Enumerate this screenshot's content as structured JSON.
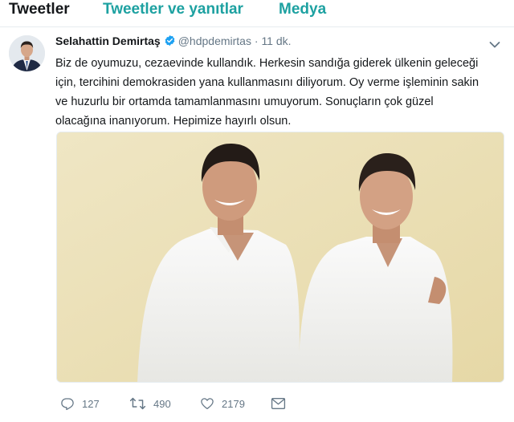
{
  "tabs": [
    {
      "label": "Tweetler",
      "active": true
    },
    {
      "label": "Tweetler ve yanıtlar",
      "active": false
    },
    {
      "label": "Medya",
      "active": false
    }
  ],
  "colors": {
    "tab_active": "#14171a",
    "tab_inactive": "#1da1a1",
    "meta": "#657786",
    "verified": "#1da1f2"
  },
  "tweet": {
    "author_name": "Selahattin Demirtaş",
    "verified_icon": "verified-badge-icon",
    "handle": "@hdpdemirtas",
    "separator": "·",
    "time": "11 dk.",
    "text_lines": [
      "Biz de oyumuzu, cezaevinde kullandık. Herkesin sandığa giderek ülkenin geleceği",
      "için, tercihini demokrasiden yana kullanmasını diliyorum. Oy verme işleminin sakin",
      "ve huzurlu bir ortamda tamamlanmasını umuyorum. Sonuçların çok güzel",
      "olacağına inanıyorum. Hepimize hayırlı olsun."
    ],
    "actions": {
      "reply_count": "127",
      "retweet_count": "490",
      "like_count": "2179"
    }
  }
}
